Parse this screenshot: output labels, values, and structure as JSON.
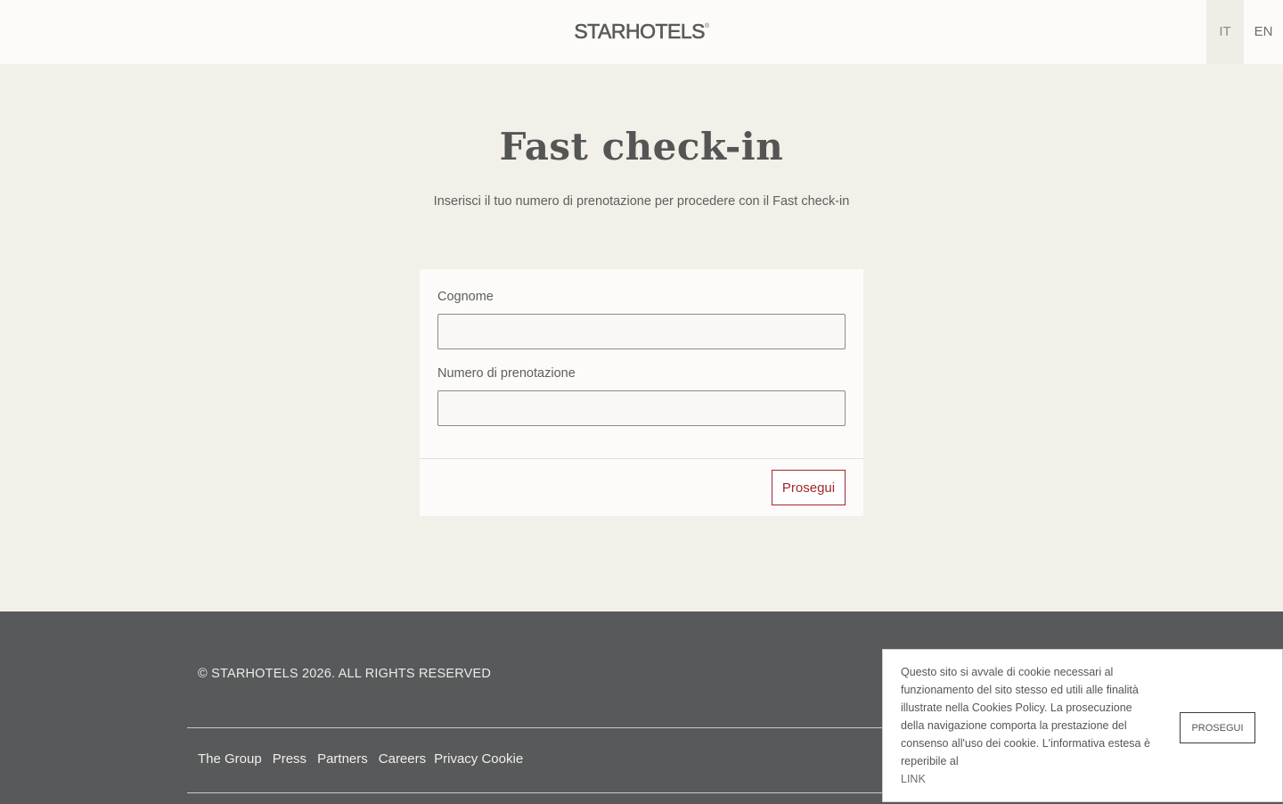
{
  "header": {
    "logo_text": "STARHOTELS",
    "logo_mark": "®",
    "languages": [
      {
        "code": "IT",
        "active": true
      },
      {
        "code": "EN",
        "active": false
      }
    ]
  },
  "main": {
    "title": "Fast check-in",
    "subtitle": "Inserisci il tuo numero di prenotazione per procedere con il Fast check-in",
    "form": {
      "surname_label": "Cognome",
      "surname_value": "",
      "booking_label": "Numero di prenotazione",
      "booking_value": "",
      "submit_label": "Prosegui"
    }
  },
  "footer": {
    "copyright": "© STARHOTELS 2026. ALL RIGHTS RESERVED",
    "links": [
      "The Group",
      "Press",
      "Partners",
      "Careers",
      "Privacy Cookie"
    ]
  },
  "cookie_banner": {
    "text": "Questo sito si avvale di cookie necessari al funzionamento del sito stesso ed utili alle finalità illustrate nella Cookies Policy. La prosecuzione della navigazione comporta la prestazione del consenso all'uso dei cookie. L'informativa estesa è reperibile al",
    "link_label": "LINK",
    "button_label": "PROSEGUI"
  },
  "colors": {
    "page_bg": "#f2f0e8",
    "header_bg": "#fcfbf9",
    "footer_bg": "#58595b",
    "accent": "#a1282b"
  }
}
